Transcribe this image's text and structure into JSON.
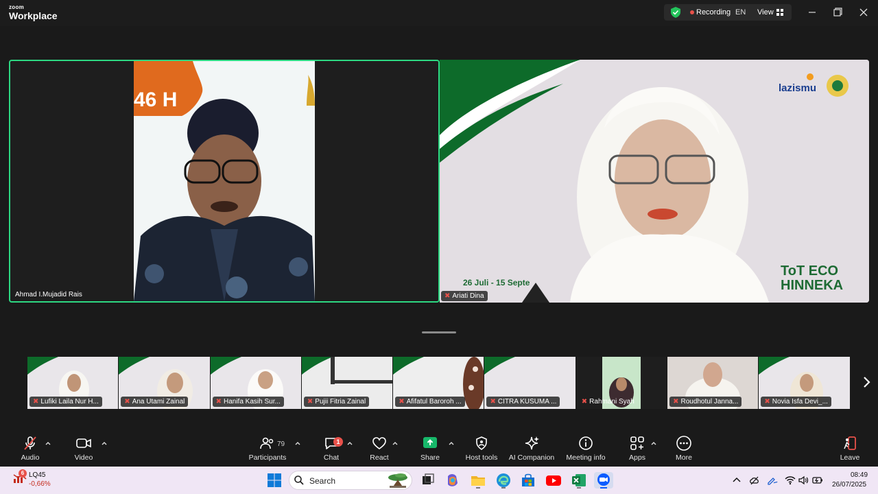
{
  "app": {
    "brand_small": "zoom",
    "brand_large": "Workplace",
    "recording_label": "Recording",
    "language": "EN",
    "view_label": "View",
    "colors": {
      "accent_green": "#2dd882",
      "recording_red": "#e8514a"
    }
  },
  "main_tiles": [
    {
      "name": "Ahmad I.Mujadid Rais",
      "banner_text": "46 H"
    },
    {
      "name": "Ariati Dina",
      "logo_text": "lazismu",
      "event_title_1": "ToT ECO",
      "event_title_2": "HINNEKA",
      "event_dates": "26 Juli - 15 Septe"
    }
  ],
  "filmstrip": [
    {
      "name": "Lufiki Laila Nur H..."
    },
    {
      "name": "Ana Utami Zainal"
    },
    {
      "name": "Hanifa Kasih Sur..."
    },
    {
      "name": "Pujii Fitria Zainal"
    },
    {
      "name": "Afifatul Baroroh ..."
    },
    {
      "name": "CITRA KUSUMA ..."
    },
    {
      "name": "Rahmani Syah"
    },
    {
      "name": "Roudhotul Janna..."
    },
    {
      "name": "Novia Isfa Devi_..."
    }
  ],
  "toolbar": {
    "audio": "Audio",
    "video": "Video",
    "participants": "Participants",
    "participants_count": "79",
    "chat": "Chat",
    "chat_badge": "1",
    "react": "React",
    "share": "Share",
    "host_tools": "Host tools",
    "ai_companion": "AI Companion",
    "meeting_info": "Meeting info",
    "apps": "Apps",
    "more": "More",
    "leave": "Leave"
  },
  "taskbar": {
    "stock_badge": "6",
    "stock_name": "LQ45",
    "stock_change": "-0,66%",
    "search_label": "Search",
    "time": "08:49",
    "date": "26/07/2025"
  }
}
